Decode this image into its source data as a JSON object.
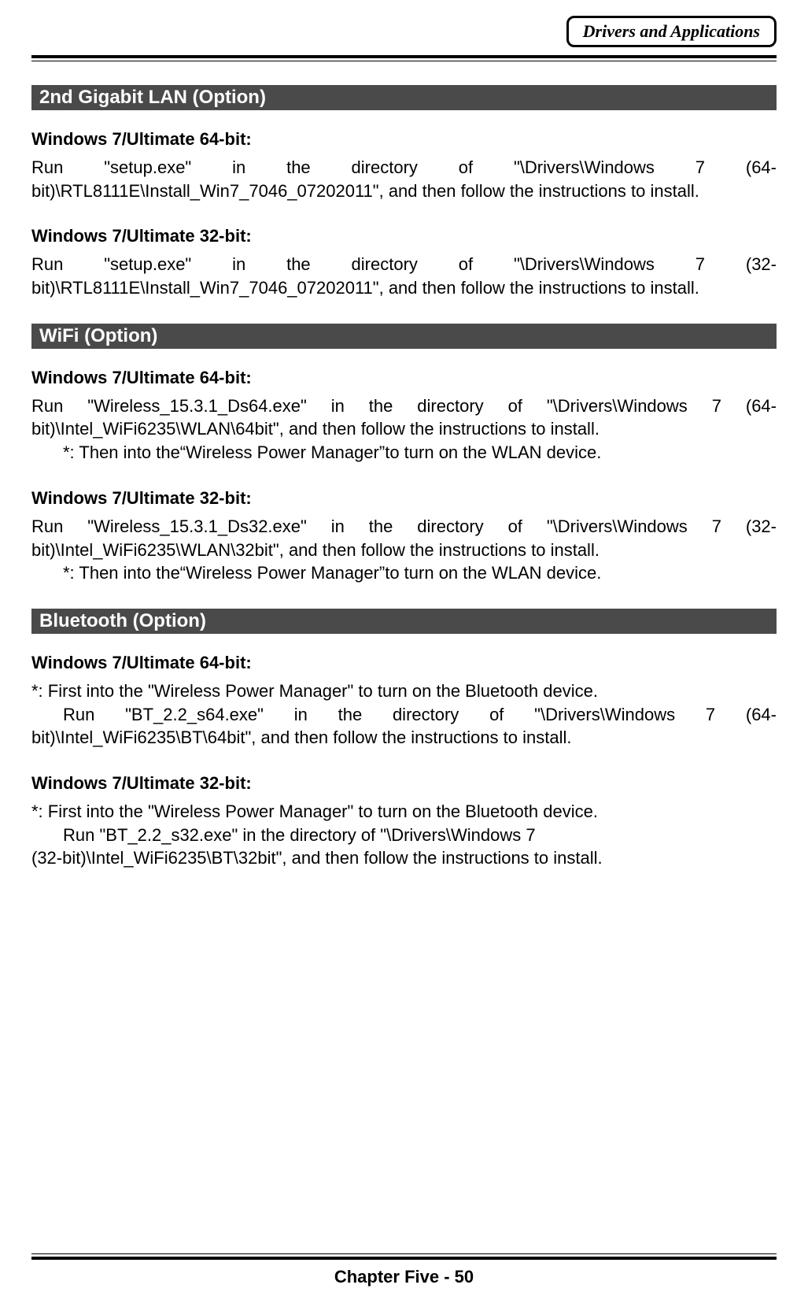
{
  "header": {
    "label": "Drivers and Applications"
  },
  "sections": [
    {
      "title": "2nd Gigabit LAN (Option)",
      "entries": [
        {
          "heading": "Windows 7/Ultimate 64-bit:",
          "justified": true,
          "lines": [
            {
              "text": "Run \"setup.exe\" in the directory of \"\\Drivers\\Windows 7 (64-bit)\\RTL8111E\\Install_Win7_7046_07202011\", and then follow the instructions to install.",
              "indent": false
            }
          ]
        },
        {
          "heading": "Windows 7/Ultimate 32-bit:",
          "justified": true,
          "lines": [
            {
              "text": "Run \"setup.exe\" in the directory of \"\\Drivers\\Windows 7 (32-bit)\\RTL8111E\\Install_Win7_7046_07202011\", and then follow the instructions to install.",
              "indent": false
            }
          ]
        }
      ]
    },
    {
      "title": "WiFi (Option)",
      "entries": [
        {
          "heading": "Windows 7/Ultimate 64-bit:",
          "justified": true,
          "lines": [
            {
              "text": "Run \"Wireless_15.3.1_Ds64.exe\" in the directory of \"\\Drivers\\Windows 7 (64-bit)\\Intel_WiFi6235\\WLAN\\64bit\", and then follow the instructions to install.",
              "indent": false
            },
            {
              "text": "*: Then into the“Wireless Power Manager”to turn on the WLAN device.",
              "indent": true
            }
          ]
        },
        {
          "heading": "Windows 7/Ultimate 32-bit:",
          "justified": true,
          "lines": [
            {
              "text": "Run \"Wireless_15.3.1_Ds32.exe\" in the directory of \"\\Drivers\\Windows 7 (32-bit)\\Intel_WiFi6235\\WLAN\\32bit\", and then follow the instructions to install.",
              "indent": false
            },
            {
              "text": "*: Then into the“Wireless Power Manager”to turn on the WLAN device.",
              "indent": true
            }
          ]
        }
      ]
    },
    {
      "title": "Bluetooth (Option)",
      "entries": [
        {
          "heading": "Windows 7/Ultimate 64-bit:",
          "justified": true,
          "lines": [
            {
              "text": "*: First into the \"Wireless Power Manager\" to turn on the Bluetooth device.",
              "indent": false
            },
            {
              "text": "Run \"BT_2.2_s64.exe\" in the directory of \"\\Drivers\\Windows 7 (64-bit)\\Intel_WiFi6235\\BT\\64bit\", and then follow the instructions to install.",
              "indent": true
            }
          ]
        },
        {
          "heading": "Windows 7/Ultimate 32-bit:",
          "justified": false,
          "lines": [
            {
              "text": "*: First into the \"Wireless Power Manager\" to turn on the Bluetooth device.",
              "indent": false
            },
            {
              "text": "Run \"BT_2.2_s32.exe\" in the directory of \"\\Drivers\\Windows 7",
              "indent": true
            },
            {
              "text": "(32-bit)\\Intel_WiFi6235\\BT\\32bit\", and then follow the instructions to install.",
              "indent": false
            }
          ]
        }
      ]
    }
  ],
  "footer": "Chapter Five - 50"
}
